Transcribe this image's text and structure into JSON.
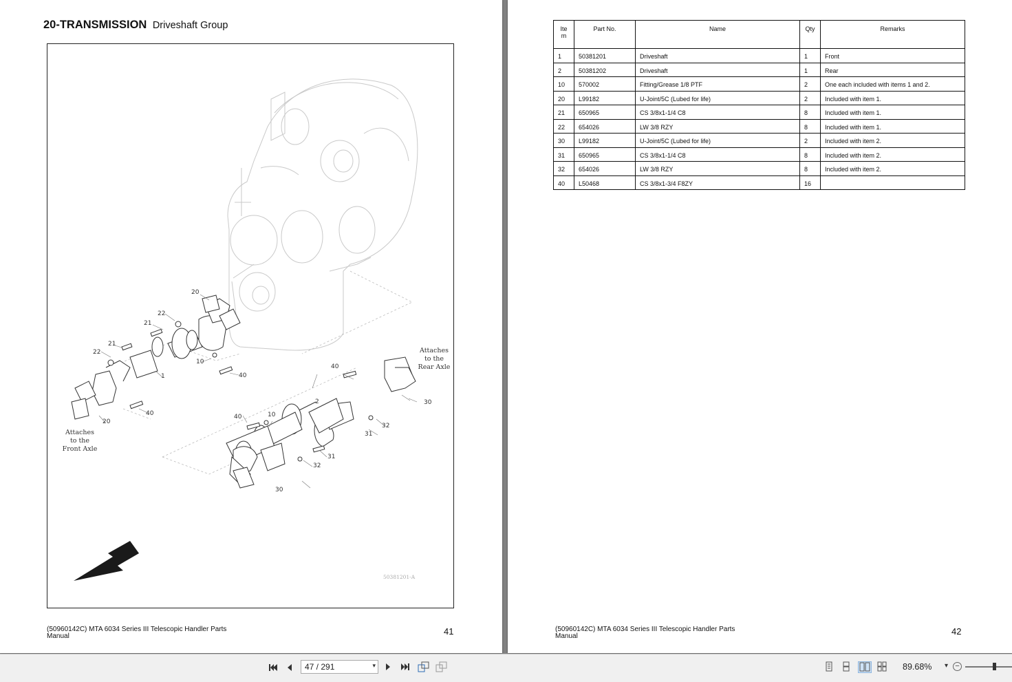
{
  "left_page": {
    "section_code": "20-TRANSMISSION",
    "section_name": "Driveshaft Group",
    "figure": {
      "callouts": [
        "20",
        "22",
        "21",
        "21",
        "22",
        "10",
        "1",
        "40",
        "20",
        "40",
        "40",
        "2",
        "10",
        "40",
        "32",
        "31",
        "31",
        "32",
        "30",
        "30",
        "20"
      ],
      "note_rear": [
        "Attaches",
        "to the",
        "Rear Axle"
      ],
      "note_front": [
        "Attaches",
        "to the",
        "Front Axle"
      ],
      "figure_id": "50381201-A"
    },
    "footer": "(50960142C) MTA 6034 Series III Telescopic Handler Parts Manual",
    "page_number": "41"
  },
  "right_page": {
    "table": {
      "headers": [
        "Ite m",
        "Part No.",
        "Name",
        "Qty",
        "Remarks"
      ],
      "rows": [
        [
          "1",
          "50381201",
          "Driveshaft",
          "1",
          "Front"
        ],
        [
          "2",
          "50381202",
          "Driveshaft",
          "1",
          "Rear"
        ],
        [
          "10",
          "570002",
          "Fitting/Grease 1/8 PTF",
          "2",
          "One each included with items 1 and 2."
        ],
        [
          "20",
          "L99182",
          "U-Joint/5C (Lubed for life)",
          "2",
          "Included with item 1."
        ],
        [
          "21",
          "650965",
          "CS 3/8x1-1/4 C8",
          "8",
          "Included with item 1."
        ],
        [
          "22",
          "654026",
          "LW 3/8 RZY",
          "8",
          "Included with item 1."
        ],
        [
          "30",
          "L99182",
          "U-Joint/5C (Lubed for life)",
          "2",
          "Included with item 2."
        ],
        [
          "31",
          "650965",
          "CS 3/8x1-1/4 C8",
          "8",
          "Included with item 2."
        ],
        [
          "32",
          "654026",
          "LW 3/8 RZY",
          "8",
          "Included with item 2."
        ],
        [
          "40",
          "L50468",
          "CS 3/8x1-3/4 F8ZY",
          "16",
          ""
        ]
      ]
    },
    "footer": "(50960142C) MTA 6034 Series III Telescopic Handler Parts Manual",
    "page_number": "42"
  },
  "toolbar": {
    "page_field": "47 / 291",
    "zoom": "89.68%",
    "icons": [
      "first-page-icon",
      "previous-page-icon",
      "next-page-icon",
      "last-page-icon",
      "rotate-icon",
      "pages-icon",
      "single-page-icon",
      "continuous-icon",
      "facing-icon",
      "continuous-facing-icon",
      "zoom-out-icon"
    ]
  }
}
